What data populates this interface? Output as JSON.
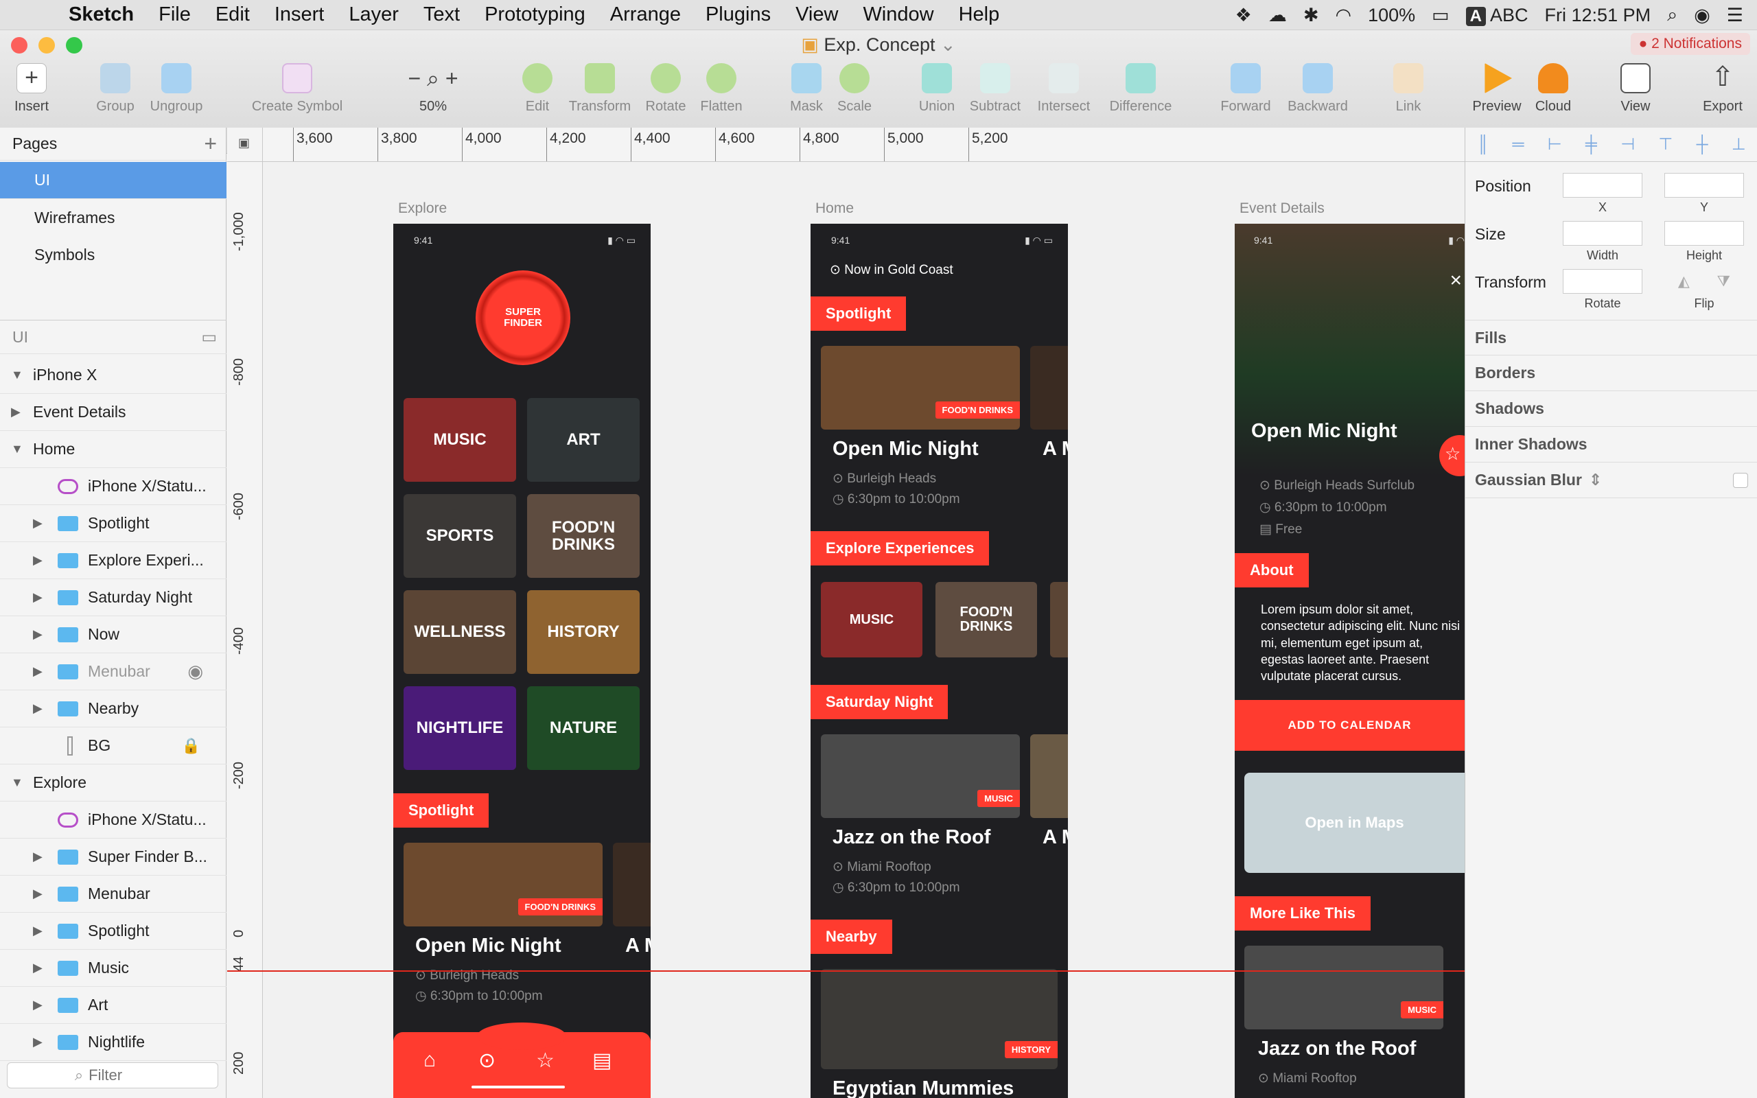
{
  "menubar": {
    "app": "Sketch",
    "items": [
      "File",
      "Edit",
      "Insert",
      "Layer",
      "Text",
      "Prototyping",
      "Arrange",
      "Plugins",
      "View",
      "Window",
      "Help"
    ],
    "battery": "100%",
    "input_source": "ABC",
    "clock": "Fri 12:51 PM"
  },
  "window": {
    "title": "Exp. Concept",
    "notifications": "2 Notifications"
  },
  "toolbar": {
    "insert": "Insert",
    "group": "Group",
    "ungroup": "Ungroup",
    "create_symbol": "Create Symbol",
    "zoom_minus": "−",
    "zoom_plus": "+",
    "zoom": "50%",
    "edit": "Edit",
    "transform": "Transform",
    "rotate": "Rotate",
    "flatten": "Flatten",
    "mask": "Mask",
    "scale": "Scale",
    "union": "Union",
    "subtract": "Subtract",
    "intersect": "Intersect",
    "difference": "Difference",
    "forward": "Forward",
    "backward": "Backward",
    "link": "Link",
    "preview": "Preview",
    "cloud": "Cloud",
    "view": "View",
    "export": "Export"
  },
  "pages": {
    "header": "Pages",
    "add": "+",
    "items": [
      "UI",
      "Wireframes",
      "Symbols"
    ]
  },
  "layers": {
    "header": "UI",
    "filter_placeholder": "Filter",
    "items": [
      "iPhone X",
      "Event Details",
      "Home",
      "iPhone X/Statu...",
      "Spotlight",
      "Explore Experi...",
      "Saturday Night",
      "Now",
      "Menubar",
      "Nearby",
      "BG",
      "Explore",
      "iPhone X/Statu...",
      "Super Finder B...",
      "Menubar",
      "Spotlight",
      "Music",
      "Art",
      "Nightlife"
    ]
  },
  "rulers": {
    "h": [
      "3,600",
      "3,800",
      "4,000",
      "4,200",
      "4,400",
      "4,600",
      "4,800",
      "5,000",
      "5,200"
    ],
    "v": [
      "-1,000",
      "-800",
      "-600",
      "-400",
      "-200",
      "0",
      "44",
      "200"
    ]
  },
  "artboards": {
    "explore": {
      "label": "Explore",
      "time": "9:41",
      "logo": "SUPER FINDER",
      "tiles": [
        "MUSIC",
        "ART",
        "SPORTS",
        "FOOD'N DRINKS",
        "WELLNESS",
        "HISTORY",
        "NIGHTLIFE",
        "NATURE"
      ],
      "spotlight": "Spotlight",
      "badge": "FOOD'N DRINKS",
      "card_title": "Open Mic Night",
      "card_title_peek": "A M",
      "card_loc": "Burleigh Heads",
      "card_time": "6:30pm to 10:00pm"
    },
    "home": {
      "label": "Home",
      "time": "9:41",
      "location": "Now in Gold Coast",
      "spotlight": "Spotlight",
      "badge1": "FOOD'N DRINKS",
      "card1_title": "Open Mic Night",
      "peek": "A M",
      "card1_loc": "Burleigh Heads",
      "card1_time": "6:30pm to 10:00pm",
      "explore": "Explore Experiences",
      "exp_tiles": [
        "MUSIC",
        "FOOD'N DRINKS"
      ],
      "saturday": "Saturday Night",
      "badge2": "MUSIC",
      "card2_title": "Jazz on the Roof",
      "card2_loc": "Miami Rooftop",
      "card2_time": "6:30pm to 10:00pm",
      "nearby": "Nearby",
      "badge3": "HISTORY",
      "card3_title": "Egyptian Mummies"
    },
    "event": {
      "label": "Event Details",
      "time": "9:41",
      "title": "Open Mic Night",
      "loc": "Burleigh Heads Surfclub",
      "time_range": "6:30pm to 10:00pm",
      "price": "Free",
      "about": "About",
      "about_text": "Lorem ipsum dolor sit amet, consectetur adipiscing elit. Nunc nisi mi, elementum eget ipsum at, egestas laoreet ante. Praesent vulputate placerat cursus.",
      "cta": "ADD TO CALENDAR",
      "maps": "Open in Maps",
      "more": "More Like This",
      "badge": "MUSIC",
      "card_title": "Jazz on the Roof",
      "card_loc": "Miami Rooftop"
    }
  },
  "inspector": {
    "position": "Position",
    "x": "X",
    "y": "Y",
    "size": "Size",
    "width": "Width",
    "height": "Height",
    "transform": "Transform",
    "rotate": "Rotate",
    "flip": "Flip",
    "sections": [
      "Fills",
      "Borders",
      "Shadows",
      "Inner Shadows",
      "Gaussian Blur"
    ]
  },
  "colors": {
    "accent": "#ff3b2f",
    "selection": "#5a9be6",
    "phone_bg": "#1f1f22"
  }
}
